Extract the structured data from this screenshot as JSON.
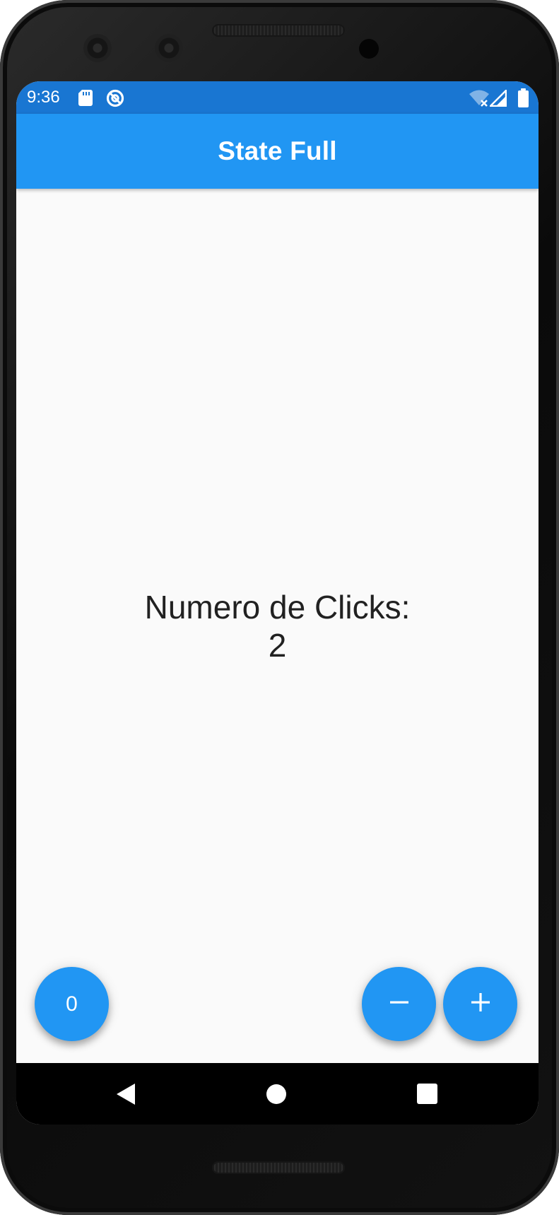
{
  "status_bar": {
    "time": "9:36",
    "icons": [
      "sd-card-icon",
      "vpn-icon",
      "wifi-off-icon",
      "signal-icon",
      "battery-icon"
    ]
  },
  "app_bar": {
    "title": "State Full"
  },
  "counter": {
    "label": "Numero de Clicks:",
    "value": "2"
  },
  "fabs": {
    "reset_label": "0",
    "minus_icon": "minus-icon",
    "plus_icon": "plus-icon"
  },
  "navigation": {
    "buttons": [
      "back-icon",
      "home-icon",
      "recents-icon"
    ]
  },
  "colors": {
    "status_bar": "#1976d2",
    "app_bar": "#2196f3",
    "fab": "#2196f3",
    "background": "#fafafa",
    "text": "#212121",
    "nav_bar": "#000000"
  }
}
